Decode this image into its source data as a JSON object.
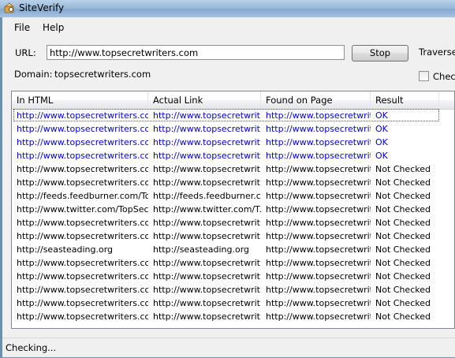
{
  "window": {
    "title": "SiteVerify"
  },
  "menu": [
    "File",
    "Help"
  ],
  "url": {
    "label": "URL:",
    "value": "http://www.topsecretwriters.com"
  },
  "stop_button": "Stop",
  "traverse": {
    "label": "Traverse"
  },
  "domain": {
    "label": "Domain:",
    "value": "topsecretwriters.com"
  },
  "check_option": {
    "label": "Check",
    "checked": false
  },
  "table": {
    "columns": [
      "In HTML",
      "Actual Link",
      "Found on Page",
      "Result"
    ],
    "rows": [
      [
        "http://www.topsecretwriters.com...",
        "http://www.topsecretwrit...",
        "http://www.topsecretwrit...",
        "OK"
      ],
      [
        "http://www.topsecretwriters.com...",
        "http://www.topsecretwrit...",
        "http://www.topsecretwrit...",
        "OK"
      ],
      [
        "http://www.topsecretwriters.com...",
        "http://www.topsecretwrit...",
        "http://www.topsecretwrit...",
        "OK"
      ],
      [
        "http://www.topsecretwriters.com...",
        "http://www.topsecretwrit...",
        "http://www.topsecretwrit...",
        "OK"
      ],
      [
        "http://www.topsecretwriters.com...",
        "http://www.topsecretwrit...",
        "http://www.topsecretwrit...",
        "Not Checked"
      ],
      [
        "http://www.topsecretwriters.com...",
        "http://www.topsecretwrit...",
        "http://www.topsecretwrit...",
        "Not Checked"
      ],
      [
        "http://feeds.feedburner.com/To...",
        "http://feeds.feedburner.c...",
        "http://www.topsecretwrit...",
        "Not Checked"
      ],
      [
        "http://www.twitter.com/TopSecr...",
        "http://www.twitter.com/T...",
        "http://www.topsecretwrit...",
        "Not Checked"
      ],
      [
        "http://www.topsecretwriters.com...",
        "http://www.topsecretwrit...",
        "http://www.topsecretwrit...",
        "Not Checked"
      ],
      [
        "http://www.topsecretwriters.com...",
        "http://www.topsecretwrit...",
        "http://www.topsecretwrit...",
        "Not Checked"
      ],
      [
        "http://seasteading.org",
        "http://seasteading.org",
        "http://www.topsecretwrit...",
        "Not Checked"
      ],
      [
        "http://www.topsecretwriters.com...",
        "http://www.topsecretwrit...",
        "http://www.topsecretwrit...",
        "Not Checked"
      ],
      [
        "http://www.topsecretwriters.com...",
        "http://www.topsecretwrit...",
        "http://www.topsecretwrit...",
        "Not Checked"
      ],
      [
        "http://www.topsecretwriters.com...",
        "http://www.topsecretwrit...",
        "http://www.topsecretwrit...",
        "Not Checked"
      ],
      [
        "http://www.topsecretwriters.com...",
        "http://www.topsecretwrit...",
        "http://www.topsecretwrit...",
        "Not Checked"
      ],
      [
        "http://www.topsecretwriters.com...",
        "http://www.topsecretwrit...",
        "http://www.topsecretwrit...",
        "Not Checked"
      ]
    ],
    "checked_row_color": "#0000e0"
  },
  "status": "Checking..."
}
